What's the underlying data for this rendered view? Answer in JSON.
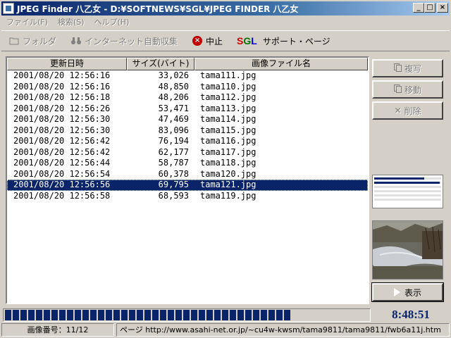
{
  "window": {
    "title": "JPEG Finder 八乙女 - D:¥SOFTNEWS¥SGL¥JPEG FINDER 八乙女",
    "buttons": {
      "minimize": "_",
      "maximize": "□",
      "close": "×"
    }
  },
  "menu": [
    "ファイル(F)",
    "検索(S)",
    "ヘルプ(H)"
  ],
  "toolbar": {
    "folder": "フォルダ",
    "auto_collect": "インターネット自動収集",
    "stop": "中止",
    "sgl_logo": [
      "S",
      "G",
      "L"
    ],
    "support": "サポート・ページ"
  },
  "list": {
    "headers": [
      "更新日時",
      "サイズ(バイト)",
      "画像ファイル名"
    ],
    "rows": [
      {
        "date": "2001/08/20 12:56:16",
        "size": "33,026",
        "name": "tama111.jpg",
        "selected": false
      },
      {
        "date": "2001/08/20 12:56:16",
        "size": "48,850",
        "name": "tama110.jpg",
        "selected": false
      },
      {
        "date": "2001/08/20 12:56:18",
        "size": "48,206",
        "name": "tama112.jpg",
        "selected": false
      },
      {
        "date": "2001/08/20 12:56:26",
        "size": "53,471",
        "name": "tama113.jpg",
        "selected": false
      },
      {
        "date": "2001/08/20 12:56:30",
        "size": "47,469",
        "name": "tama114.jpg",
        "selected": false
      },
      {
        "date": "2001/08/20 12:56:30",
        "size": "83,096",
        "name": "tama115.jpg",
        "selected": false
      },
      {
        "date": "2001/08/20 12:56:42",
        "size": "76,194",
        "name": "tama116.jpg",
        "selected": false
      },
      {
        "date": "2001/08/20 12:56:42",
        "size": "62,177",
        "name": "tama117.jpg",
        "selected": false
      },
      {
        "date": "2001/08/20 12:56:44",
        "size": "58,787",
        "name": "tama118.jpg",
        "selected": false
      },
      {
        "date": "2001/08/20 12:56:54",
        "size": "60,378",
        "name": "tama120.jpg",
        "selected": false
      },
      {
        "date": "2001/08/20 12:56:56",
        "size": "69,795",
        "name": "tama121.jpg",
        "selected": true
      },
      {
        "date": "2001/08/20 12:56:58",
        "size": "68,593",
        "name": "tama119.jpg",
        "selected": false
      }
    ]
  },
  "side": {
    "copy": "複写",
    "move": "移動",
    "delete": "削除",
    "show": "表示",
    "levels": [
      0.75,
      0.98,
      0,
      0,
      0,
      0
    ]
  },
  "progress": {
    "fraction": 0.81
  },
  "clock": "8:48:51",
  "status": {
    "image_number": "画像番号：11/12",
    "page": "ページ http://www.asahi-net.or.jp/~cu4w-kwsm/tama9811/tama9811/fwb6a11j.htm"
  },
  "colors": {
    "selection": "#0a246a",
    "titlebar": "#0a246a",
    "clock": "#0a246a"
  }
}
